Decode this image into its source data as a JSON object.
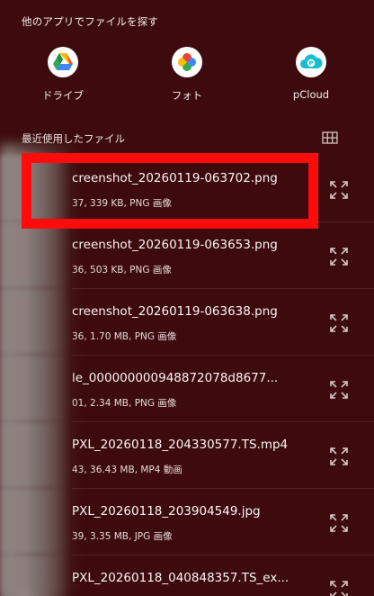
{
  "section_title": "他のアプリでファイルを探す",
  "apps": [
    {
      "label": "ドライブ",
      "icon": "google-drive-icon"
    },
    {
      "label": "フォト",
      "icon": "google-photos-icon"
    },
    {
      "label": "pCloud",
      "icon": "pcloud-icon"
    }
  ],
  "recent_header": "最近使用したファイル",
  "grid_toggle_icon": "grid-view-icon",
  "files": [
    {
      "name": "creenshot_20260119-063702.png",
      "meta": "37, 339 KB, PNG 画像"
    },
    {
      "name": "creenshot_20260119-063653.png",
      "meta": "36, 503 KB, PNG 画像"
    },
    {
      "name": "creenshot_20260119-063638.png",
      "meta": "36, 1.70 MB, PNG 画像"
    },
    {
      "name": "le_000000000948872078d8677...",
      "meta": "01, 2.34 MB, PNG 画像"
    },
    {
      "name": "PXL_20260118_204330577.TS.mp4",
      "meta": "43, 36.43 MB, MP4 動画"
    },
    {
      "name": "PXL_20260118_203904549.jpg",
      "meta": "39, 3.35 MB, JPG 画像"
    },
    {
      "name": "PXL_20260118_040848357.TS_ex...",
      "meta": ""
    }
  ],
  "colors": {
    "background": "#3d0b0d",
    "highlight": "#ff0b0b",
    "text": "#fbf5f5"
  }
}
